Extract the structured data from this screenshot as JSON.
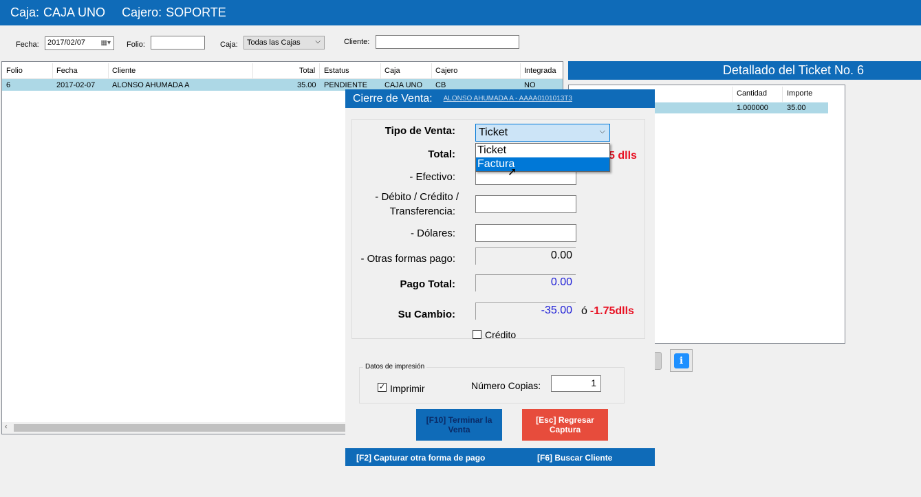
{
  "header": {
    "caja_label": "Caja:",
    "caja_value": "CAJA UNO",
    "cajero_label": "Cajero:",
    "cajero_value": "SOPORTE"
  },
  "filters": {
    "fecha_label": "Fecha:",
    "fecha_value": "2017/02/07",
    "folio_label": "Folio:",
    "folio_value": "",
    "caja_label": "Caja:",
    "caja_value": "Todas las Cajas",
    "cliente_label": "Cliente:",
    "cliente_value": ""
  },
  "tickets_grid": {
    "columns": [
      "Folio",
      "Fecha",
      "Cliente",
      "Total",
      "Estatus",
      "Caja",
      "Cajero",
      "Integrada"
    ],
    "rows": [
      [
        "6",
        "2017-02-07",
        "ALONSO AHUMADA A",
        "35.00",
        "PENDIENTE",
        "CAJA UNO",
        "CB",
        "NO"
      ]
    ]
  },
  "detail": {
    "title": "Detallado del Ticket No. 6",
    "columns": [
      "Cantidad",
      "Importe"
    ],
    "rows": [
      [
        "1.000000",
        "35.00"
      ]
    ]
  },
  "dialog": {
    "title": "Cierre de Venta:",
    "customer": "ALONSO AHUMADA A - AAAA0101013T3",
    "tipo_venta_label": "Tipo de Venta:",
    "tipo_venta_value": "Ticket",
    "tipo_venta_options": [
      "Ticket",
      "Factura"
    ],
    "tipo_venta_highlighted": "Factura",
    "total_label": "Total:",
    "total_dlls_partial": "5 dlls",
    "efectivo_label": "- Efectivo:",
    "efectivo_value": "",
    "debito_label_1": "- Débito / Crédito /",
    "debito_label_2": "Transferencia:",
    "debito_value": "",
    "dolares_label": "- Dólares:",
    "dolares_value": "",
    "otras_label": "- Otras formas pago:",
    "otras_value": "0.00",
    "pago_total_label": "Pago Total:",
    "pago_total_value": "0.00",
    "cambio_label": "Su Cambio:",
    "cambio_value": "-35.00",
    "cambio_or": "ó",
    "cambio_dlls": "-1.75dlls",
    "credito_label": "Crédito",
    "credito_checked": false,
    "print_group_title": "Datos de impresión",
    "imprimir_label": "Imprimir",
    "imprimir_checked": true,
    "copias_label": "Número Copias:",
    "copias_value": "1",
    "terminar_button": "[F10] Terminar la Venta",
    "regresar_button": "[Esc] Regresar Captura",
    "footer_f2": "[F2] Capturar otra forma de pago",
    "footer_f6": "[F6] Buscar Cliente"
  },
  "colors": {
    "brand_blue": "#0f6bb8",
    "row_highlight": "#add8e6",
    "danger_red": "#e74c3c",
    "amount_red": "#e81123",
    "amount_blue": "#1a1ad6"
  },
  "icons": {
    "calendar": "calendar-icon",
    "chevron": "chevron-down-icon",
    "info": "info-icon",
    "cursor": "mouse-cursor-icon"
  }
}
